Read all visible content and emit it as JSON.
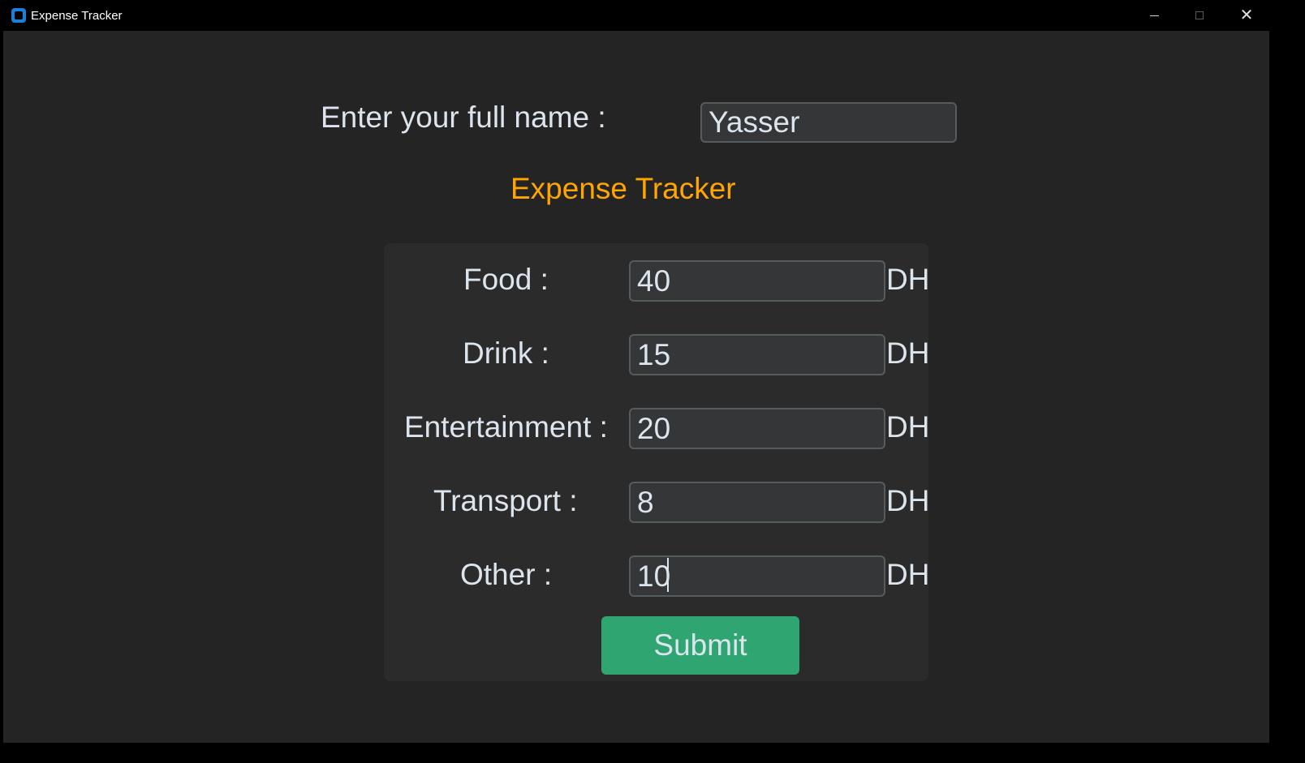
{
  "window": {
    "title": "Expense Tracker",
    "controls": {
      "minimize": "minimize-icon",
      "maximize": "maximize-icon",
      "close": "close-icon"
    }
  },
  "name_prompt": {
    "label": "Enter your full name :",
    "value": "Yasser"
  },
  "heading": "Expense Tracker",
  "expenses": [
    {
      "label": "Food :",
      "value": "40",
      "unit": "DH"
    },
    {
      "label": "Drink :",
      "value": "15",
      "unit": "DH"
    },
    {
      "label": "Entertainment :",
      "value": "20",
      "unit": "DH"
    },
    {
      "label": "Transport :",
      "value": "8",
      "unit": "DH"
    },
    {
      "label": "Other :",
      "value": "10",
      "unit": "DH"
    }
  ],
  "submit_label": "Submit",
  "colors": {
    "heading": "#ffa500",
    "submit": "#2fa572",
    "background": "#242424",
    "panel": "#2b2b2b"
  }
}
